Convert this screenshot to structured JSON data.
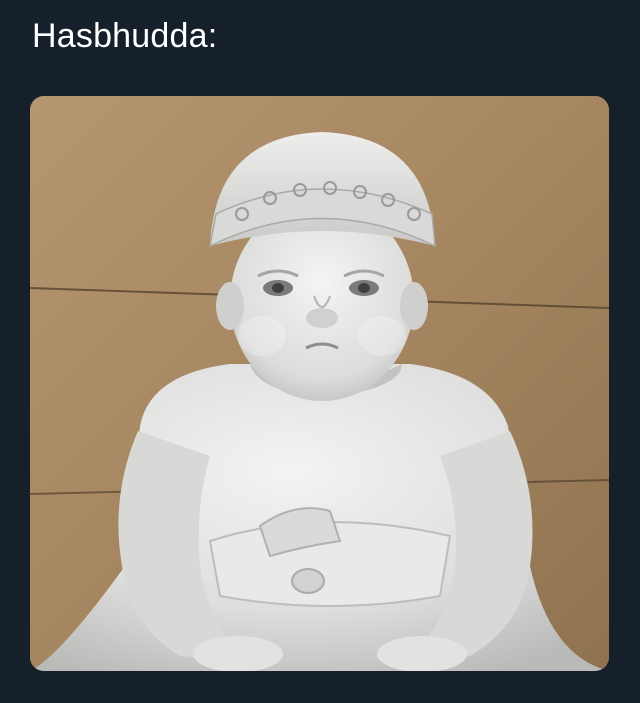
{
  "tweet": {
    "text": "Hasbhudda:"
  },
  "media": {
    "description": "marble-statue-photo",
    "colors": {
      "background": "#15202b",
      "wall": "#a98a63",
      "marble": "#e4e4e2"
    }
  }
}
